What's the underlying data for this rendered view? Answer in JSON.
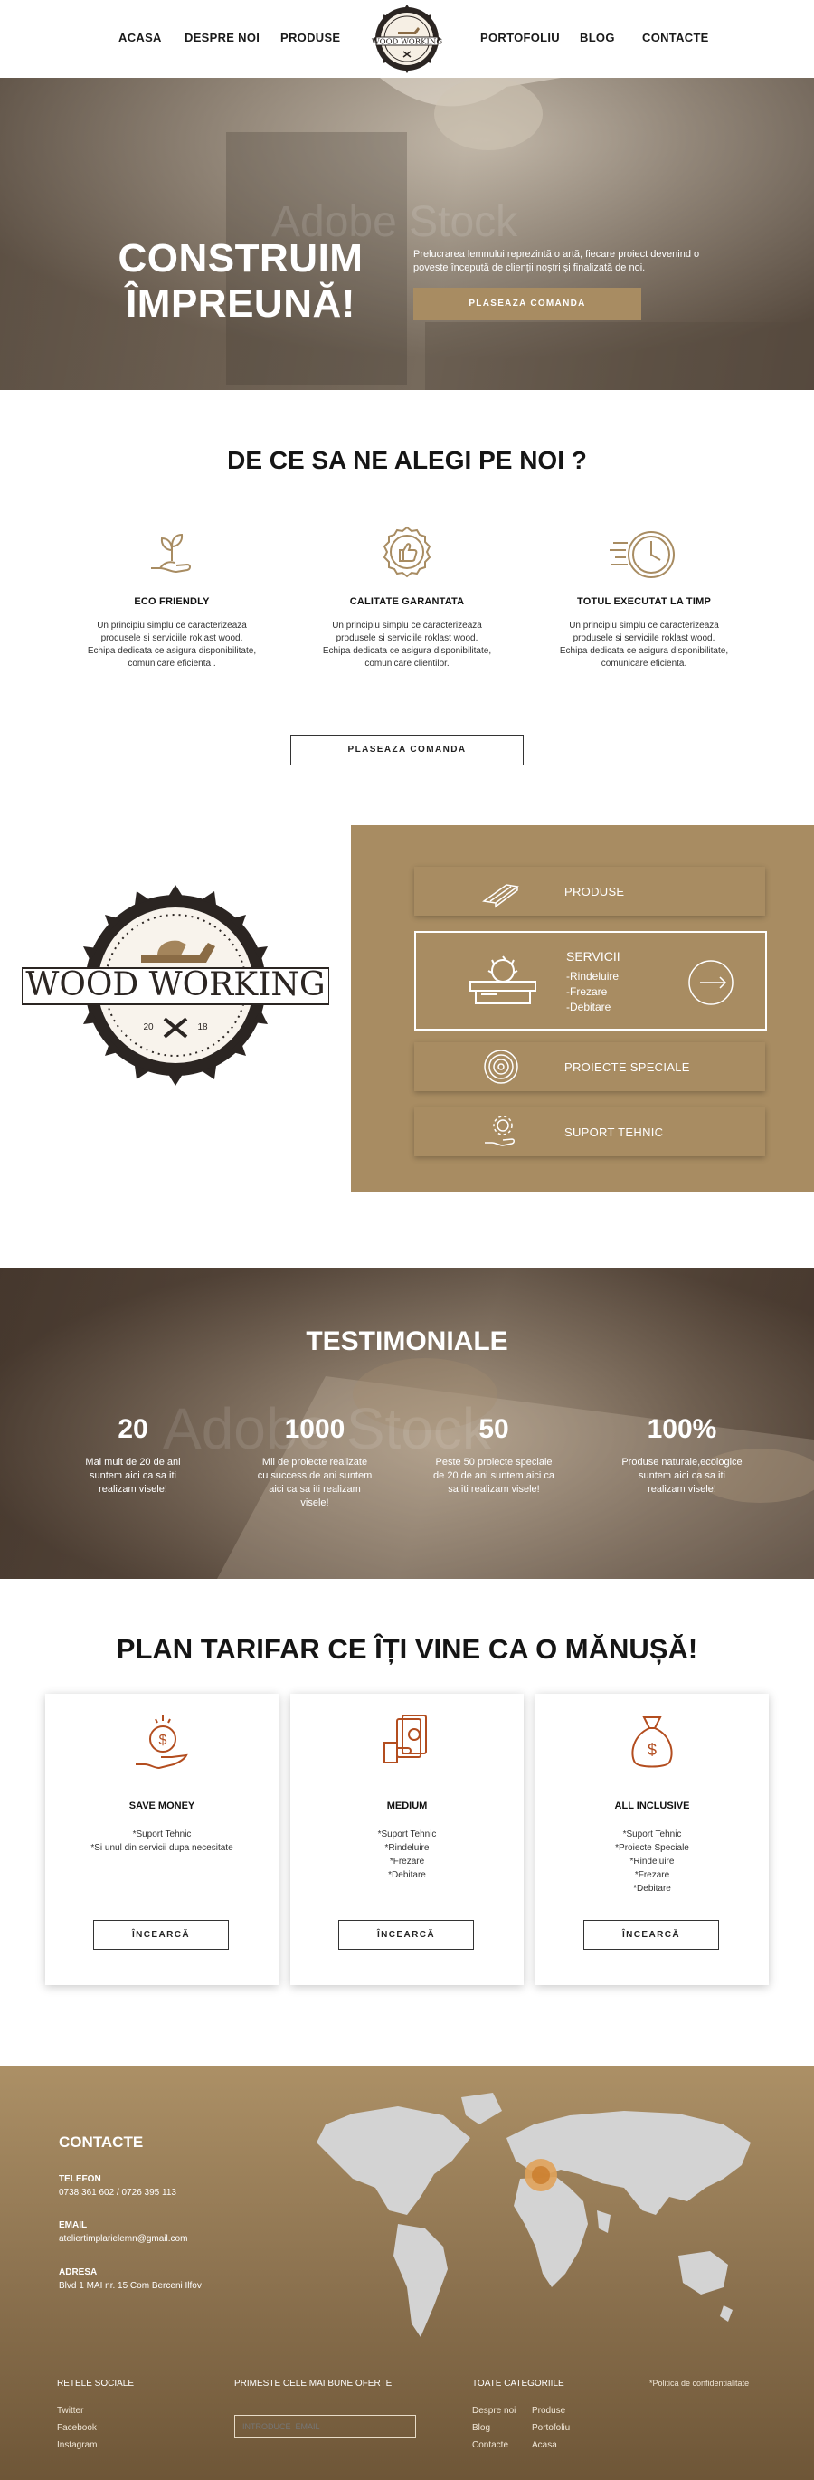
{
  "nav": {
    "left": [
      "ACASA",
      "DESPRE NOI",
      "PRODUSE"
    ],
    "right": [
      "PORTOFOLIU",
      "BLOG",
      "CONTACTE"
    ],
    "logo_text": "WOOD WORKING"
  },
  "hero": {
    "title_line1": "CONSTRUIM",
    "title_line2": "ÎMPREUNĂ!",
    "text": "Prelucrarea lemnului reprezintă o artă, fiecare proiect devenind o poveste începută de clienții noștri și finalizată de noi.",
    "button": "PLASEAZA COMANDA"
  },
  "why": {
    "title": "DE CE SA NE ALEGI PE NOI ?",
    "features": [
      {
        "icon": "plant-hand-icon",
        "title": "ECO FRIENDLY",
        "l1": "Un principiu simplu ce caracterizeaza",
        "l2": "produsele si serviciile roklast wood.",
        "l3": "Echipa dedicata ce asigura disponibilitate,",
        "l4": "comunicare eficienta ."
      },
      {
        "icon": "thumbs-up-badge-icon",
        "title": "CALITATE GARANTATA",
        "l1": "Un principiu simplu ce caracterizeaza",
        "l2": "produsele si serviciile roklast wood.",
        "l3": "Echipa dedicata ce asigura disponibilitate,",
        "l4": "comunicare  clientilor."
      },
      {
        "icon": "fast-clock-icon",
        "title": "TOTUL EXECUTAT LA TIMP",
        "l1": "Un principiu simplu ce caracterizeaza",
        "l2": "produsele si serviciile roklast wood.",
        "l3": "Echipa dedicata ce asigura disponibilitate,",
        "l4": "comunicare eficienta."
      }
    ],
    "button": "PLASEAZA  COMANDA"
  },
  "services": {
    "logo_text": "WOOD WORKING",
    "logo_year_left": "20",
    "logo_year_right": "18",
    "items": [
      {
        "icon": "planks-icon",
        "label": "PRODUSE"
      },
      {
        "icon": "saw-table-icon",
        "label": "SERVICII",
        "sub1": "-Rindeluire",
        "sub2": "-Frezare",
        "sub3": "-Debitare"
      },
      {
        "icon": "wood-rings-icon",
        "label": "PROIECTE SPECIALE"
      },
      {
        "icon": "gear-hand-icon",
        "label": "SUPORT TEHNIC"
      }
    ],
    "colors": {
      "panel": "#a88c62"
    }
  },
  "testimonials": {
    "title": "TESTIMONIALE",
    "watermark": "Adobe Stock",
    "stats": [
      {
        "num": "20",
        "l1": "Mai mult de 20 de ani",
        "l2": "suntem aici ca sa iti",
        "l3": "realizam visele!",
        "l4": ""
      },
      {
        "num": "1000",
        "l1": "Mii de proiecte realizate",
        "l2": "cu success de ani suntem",
        "l3": "aici ca sa iti realizam",
        "l4": "visele!"
      },
      {
        "num": "50",
        "l1": "Peste 50 proiecte speciale",
        "l2": "de 20 de ani suntem aici ca",
        "l3": "sa iti realizam visele!",
        "l4": ""
      },
      {
        "num": "100%",
        "l1": "Produse naturale,ecologice",
        "l2": "suntem aici ca sa iti",
        "l3": "realizam visele!",
        "l4": ""
      }
    ]
  },
  "pricing": {
    "title": "PLAN TARIFAR CE ÎȚI VINE CA O MĂNUȘĂ!",
    "plans": [
      {
        "icon": "money-hand-icon",
        "name": "SAVE MONEY",
        "features": [
          "*Suport Tehnic",
          "*Si unul din servicii dupa necesitate"
        ],
        "button": "ÎNCEARCĂ"
      },
      {
        "icon": "cash-hand-icon",
        "name": "MEDIUM",
        "features": [
          "*Suport Tehnic",
          "*Rindeluire",
          "*Frezare",
          "*Debitare"
        ],
        "button": "ÎNCEARCĂ"
      },
      {
        "icon": "money-bag-icon",
        "name": "ALL INCLUSIVE",
        "features": [
          "*Suport Tehnic",
          "*Proiecte Speciale",
          "*Rindeluire",
          "*Frezare",
          "*Debitare"
        ],
        "button": "ÎNCEARCĂ"
      }
    ]
  },
  "footer": {
    "contacts_title": "CONTACTE",
    "phone_label": "TELEFON",
    "phone": "0738 361 602 / 0726 395 113",
    "email_label": "EMAIL",
    "email": "ateliertimplarielemn@gmail.com",
    "address_label": "ADRESA",
    "address": "Blvd 1 MAI nr. 15 Com Berceni Ilfov",
    "social_title": "RETELE SOCIALE",
    "social": [
      "Twitter",
      "Facebook",
      "Instagram"
    ],
    "newsletter_title": "PRIMESTE  CELE MAI BUNE OFERTE",
    "newsletter_placeholder": "INTRODUCE  EMAIL",
    "categories_title": "TOATE CATEGORIILE",
    "categories_col1": [
      "Despre noi",
      "Blog",
      "Contacte"
    ],
    "categories_col2": [
      "Produse",
      "Portofoliu",
      "Acasa"
    ],
    "policy": "*Politica de confidentialitate"
  }
}
